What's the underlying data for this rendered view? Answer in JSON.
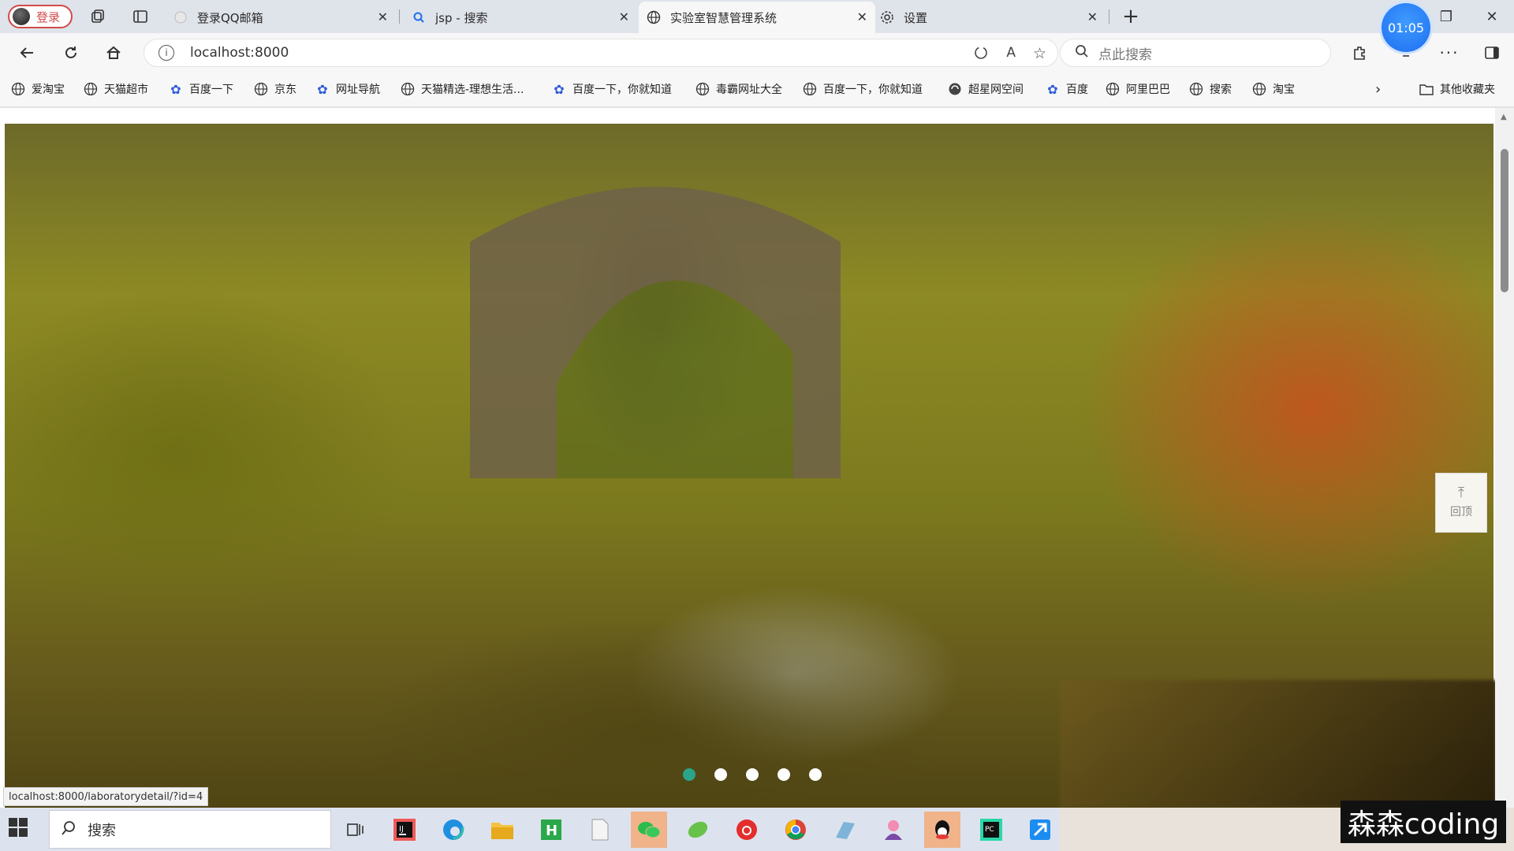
{
  "browser": {
    "profile_label": "登录",
    "tabs": [
      {
        "label": "登录QQ邮箱",
        "active": false
      },
      {
        "label": "jsp - 搜索",
        "active": false
      },
      {
        "label": "实验室智慧管理系统",
        "active": true
      },
      {
        "label": "设置",
        "active": false
      }
    ],
    "clock": "01:05",
    "address": "localhost:8000",
    "search_placeholder": "点此搜索",
    "bookmarks": [
      "爱淘宝",
      "天猫超市",
      "百度一下",
      "京东",
      "网址导航",
      "天猫精选-理想生活...",
      "百度一下，你就知道",
      "毒霸网址大全",
      "百度一下，你就知道",
      "超星网空间",
      "百度",
      "阿里巴巴",
      "搜索",
      "淘宝"
    ],
    "other_bookmarks": "其他收藏夹",
    "status_url": "localhost:8000/laboratorydetail/?id=4"
  },
  "page": {
    "back_to_top": "回顶",
    "carousel": {
      "slide_count": 5,
      "active_index": 0
    },
    "colors": {
      "accent": "#2aa58c"
    }
  },
  "taskbar": {
    "search_label": "搜索",
    "apps": [
      "task-view",
      "intellij",
      "edge",
      "file-explorer",
      "hbuilder",
      "notepad",
      "wechat",
      "app-green",
      "netease-music",
      "chrome",
      "app-blue",
      "app-pink",
      "qq",
      "pycharm",
      "app-arrow"
    ]
  },
  "watermark": "森森coding"
}
